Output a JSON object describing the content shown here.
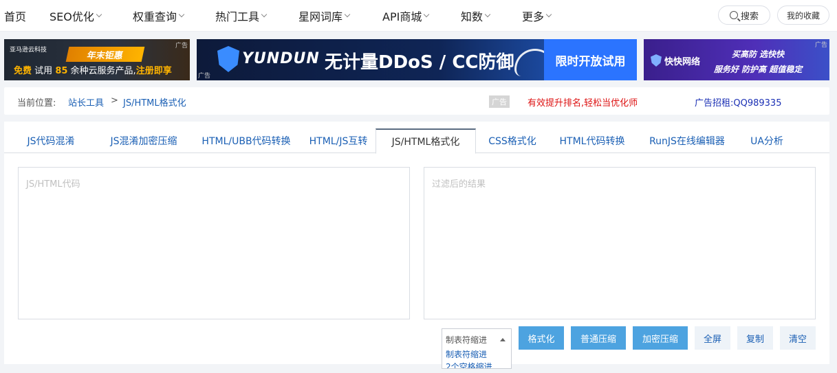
{
  "nav": {
    "home": "首页",
    "items": [
      {
        "label": "SEO优化"
      },
      {
        "label": "权重查询"
      },
      {
        "label": "热门工具"
      },
      {
        "label": "星网词库"
      },
      {
        "label": "API商城"
      },
      {
        "label": "知数"
      },
      {
        "label": "更多"
      }
    ],
    "search": "搜索",
    "favorites": "我的收藏"
  },
  "ads": {
    "tag": "广告",
    "ad1": {
      "brand": "亚马逊云科技",
      "badge": "年末钜惠",
      "free": "免费",
      "try": "试用",
      "count": "85",
      "rest": "余种云服务产品,",
      "register": "注册即享"
    },
    "ad2": {
      "logo": "YUNDUN",
      "headline": "无计量DDoS / CC防御",
      "cta": "限时开放试用"
    },
    "ad3": {
      "logo": "快快网络",
      "line1": "买高防 选快快",
      "line2": "服务好 防护高 超值稳定"
    }
  },
  "breadcrumb": {
    "label": "当前位置:",
    "link": "站长工具",
    "separator": ">",
    "current": "JS/HTML格式化",
    "ad_tag": "广告",
    "promo": "有效提升排名,轻松当优化师",
    "ad_contact": "广告招租:QQ989335"
  },
  "tabs": [
    {
      "label": "JS代码混淆"
    },
    {
      "label": "JS混淆加密压缩"
    },
    {
      "label": "HTML/UBB代码转换"
    },
    {
      "label": "HTML/JS互转"
    },
    {
      "label": "JS/HTML格式化"
    },
    {
      "label": "CSS格式化"
    },
    {
      "label": "HTML代码转换"
    },
    {
      "label": "RunJS在线编辑器"
    },
    {
      "label": "UA分析"
    }
  ],
  "editor": {
    "input_placeholder": "JS/HTML代码",
    "output_placeholder": "过滤后的结果"
  },
  "indent": {
    "selected": "制表符缩进",
    "options": [
      "制表符缩进",
      "2个空格缩进"
    ]
  },
  "buttons": {
    "format": "格式化",
    "compress": "普通压缩",
    "encrypt": "加密压缩",
    "fullscreen": "全屏",
    "copy": "复制",
    "clear": "清空"
  }
}
